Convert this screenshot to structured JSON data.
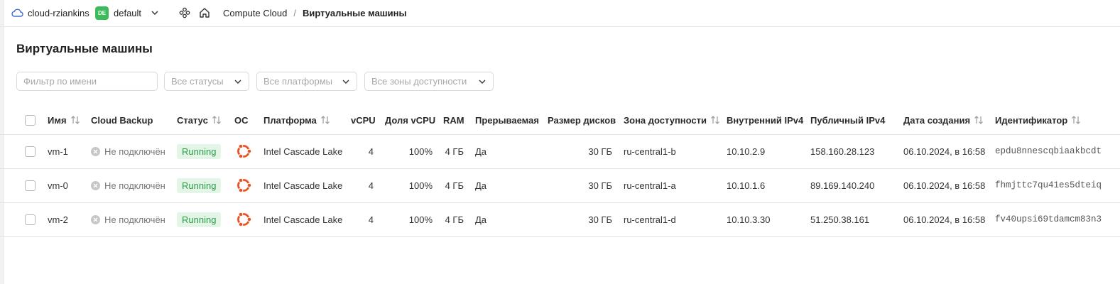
{
  "header": {
    "cloud_name": "cloud-rziankins",
    "folder_badge": "DE",
    "folder_name": "default",
    "breadcrumb_service": "Compute Cloud",
    "breadcrumb_separator": "/",
    "breadcrumb_current": "Виртуальные машины"
  },
  "page": {
    "title": "Виртуальные машины"
  },
  "filters": {
    "name_placeholder": "Фильтр по имени",
    "status": "Все статусы",
    "platform": "Все платформы",
    "zone": "Все зоны доступности"
  },
  "table": {
    "columns": {
      "name": "Имя",
      "backup": "Cloud Backup",
      "status": "Статус",
      "os": "ОС",
      "platform": "Платформа",
      "vcpu": "vCPU",
      "vcpu_share": "Доля vCPU",
      "ram": "RAM",
      "preemptible": "Прерываемая",
      "disk_size": "Размер дисков",
      "zone": "Зона доступности",
      "internal_ip": "Внутренний IPv4",
      "public_ip": "Публичный IPv4",
      "created": "Дата создания",
      "id": "Идентификатор"
    },
    "rows": [
      {
        "name": "vm-1",
        "backup": "Не подключён",
        "status": "Running",
        "os_icon": "ubuntu-icon",
        "platform": "Intel Cascade Lake",
        "vcpu": "4",
        "vcpu_share": "100%",
        "ram": "4 ГБ",
        "preemptible": "Да",
        "disk_size": "30 ГБ",
        "zone": "ru-central1-b",
        "internal_ip": "10.10.2.9",
        "public_ip": "158.160.28.123",
        "created": "06.10.2024, в 16:58",
        "id": "epdu8nnescqbiaakbcdt"
      },
      {
        "name": "vm-0",
        "backup": "Не подключён",
        "status": "Running",
        "os_icon": "ubuntu-icon",
        "platform": "Intel Cascade Lake",
        "vcpu": "4",
        "vcpu_share": "100%",
        "ram": "4 ГБ",
        "preemptible": "Да",
        "disk_size": "30 ГБ",
        "zone": "ru-central1-a",
        "internal_ip": "10.10.1.6",
        "public_ip": "89.169.140.240",
        "created": "06.10.2024, в 16:58",
        "id": "fhmjttc7qu41es5dteiq"
      },
      {
        "name": "vm-2",
        "backup": "Не подключён",
        "status": "Running",
        "os_icon": "ubuntu-icon",
        "platform": "Intel Cascade Lake",
        "vcpu": "4",
        "vcpu_share": "100%",
        "ram": "4 ГБ",
        "preemptible": "Да",
        "disk_size": "30 ГБ",
        "zone": "ru-central1-d",
        "internal_ip": "10.10.3.30",
        "public_ip": "51.250.38.161",
        "created": "06.10.2024, в 16:58",
        "id": "fv40upsi69tdamcm83n3"
      }
    ]
  },
  "colors": {
    "accent_cloud": "#3f6ad8",
    "folder_badge": "#3bbb59",
    "status_running_bg": "#e3f5e6",
    "status_running_text": "#2e9a47",
    "ubuntu": "#e95420"
  }
}
